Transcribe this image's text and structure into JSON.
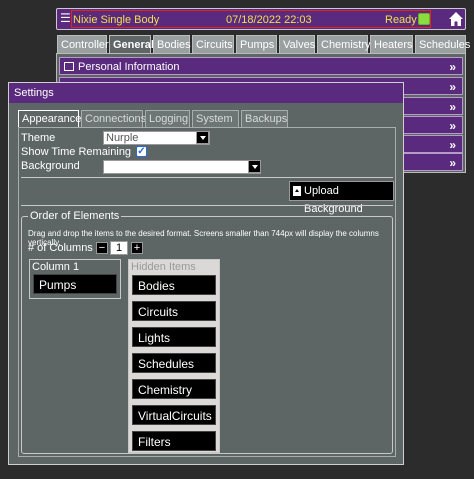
{
  "topbar": {
    "system_name": "Nixie Single Body",
    "datetime": "07/18/2022 22:03",
    "status": "Ready",
    "colors": {
      "bar": "#5a2a7e",
      "text": "#f3e04b",
      "led": "#8bdc3c"
    }
  },
  "nav": {
    "tabs": [
      "Controller",
      "General",
      "Bodies",
      "Circuits",
      "Pumps",
      "Valves",
      "Chemistry",
      "Heaters",
      "Schedules"
    ],
    "active": "General"
  },
  "background_page": {
    "sections": [
      "Personal Information",
      "",
      "",
      "",
      "",
      ""
    ]
  },
  "settings": {
    "title": "Settings",
    "tabs": [
      "Appearance",
      "Connections",
      "Logging",
      "System",
      "Backups"
    ],
    "active_tab": "Appearance",
    "theme_label": "Theme",
    "theme_value": "Nurple",
    "show_time_label": "Show Time Remaining",
    "show_time_checked": true,
    "checkbox_mark": "✓",
    "background_label": "Background",
    "background_value": "",
    "upload_label": "Upload Background",
    "order": {
      "legend": "Order of Elements",
      "help": "Drag and drop the items to the desired format. Screens smaller than 744px will display the columns vertically.",
      "columns_label": "# of Columns",
      "minus": "−",
      "plus": "+",
      "columns_value": "1",
      "column1_title": "Column 1",
      "column1_items": [
        "Pumps"
      ],
      "hidden_title": "Hidden Items",
      "hidden_items": [
        "Bodies",
        "Circuits",
        "Lights",
        "Schedules",
        "Chemistry",
        "VirtualCircuits",
        "Filters"
      ]
    }
  }
}
